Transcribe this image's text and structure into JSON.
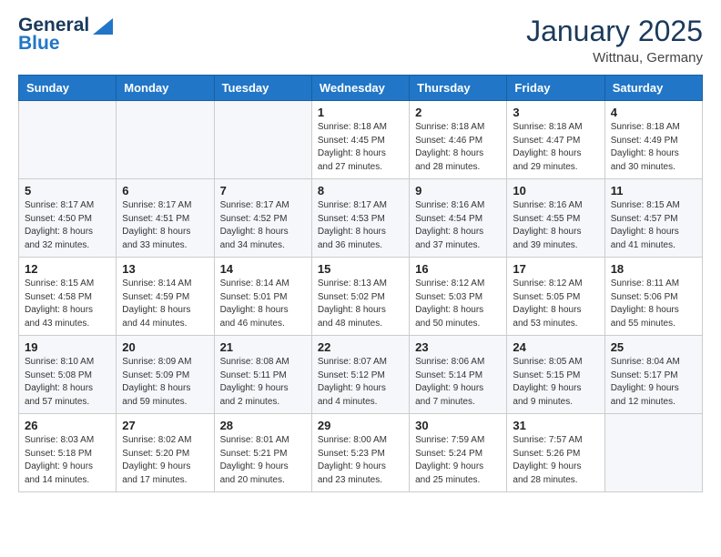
{
  "logo": {
    "general": "General",
    "blue": "Blue"
  },
  "title": "January 2025",
  "location": "Wittnau, Germany",
  "days_header": [
    "Sunday",
    "Monday",
    "Tuesday",
    "Wednesday",
    "Thursday",
    "Friday",
    "Saturday"
  ],
  "weeks": [
    [
      {
        "day": "",
        "info": ""
      },
      {
        "day": "",
        "info": ""
      },
      {
        "day": "",
        "info": ""
      },
      {
        "day": "1",
        "info": "Sunrise: 8:18 AM\nSunset: 4:45 PM\nDaylight: 8 hours and 27 minutes."
      },
      {
        "day": "2",
        "info": "Sunrise: 8:18 AM\nSunset: 4:46 PM\nDaylight: 8 hours and 28 minutes."
      },
      {
        "day": "3",
        "info": "Sunrise: 8:18 AM\nSunset: 4:47 PM\nDaylight: 8 hours and 29 minutes."
      },
      {
        "day": "4",
        "info": "Sunrise: 8:18 AM\nSunset: 4:49 PM\nDaylight: 8 hours and 30 minutes."
      }
    ],
    [
      {
        "day": "5",
        "info": "Sunrise: 8:17 AM\nSunset: 4:50 PM\nDaylight: 8 hours and 32 minutes."
      },
      {
        "day": "6",
        "info": "Sunrise: 8:17 AM\nSunset: 4:51 PM\nDaylight: 8 hours and 33 minutes."
      },
      {
        "day": "7",
        "info": "Sunrise: 8:17 AM\nSunset: 4:52 PM\nDaylight: 8 hours and 34 minutes."
      },
      {
        "day": "8",
        "info": "Sunrise: 8:17 AM\nSunset: 4:53 PM\nDaylight: 8 hours and 36 minutes."
      },
      {
        "day": "9",
        "info": "Sunrise: 8:16 AM\nSunset: 4:54 PM\nDaylight: 8 hours and 37 minutes."
      },
      {
        "day": "10",
        "info": "Sunrise: 8:16 AM\nSunset: 4:55 PM\nDaylight: 8 hours and 39 minutes."
      },
      {
        "day": "11",
        "info": "Sunrise: 8:15 AM\nSunset: 4:57 PM\nDaylight: 8 hours and 41 minutes."
      }
    ],
    [
      {
        "day": "12",
        "info": "Sunrise: 8:15 AM\nSunset: 4:58 PM\nDaylight: 8 hours and 43 minutes."
      },
      {
        "day": "13",
        "info": "Sunrise: 8:14 AM\nSunset: 4:59 PM\nDaylight: 8 hours and 44 minutes."
      },
      {
        "day": "14",
        "info": "Sunrise: 8:14 AM\nSunset: 5:01 PM\nDaylight: 8 hours and 46 minutes."
      },
      {
        "day": "15",
        "info": "Sunrise: 8:13 AM\nSunset: 5:02 PM\nDaylight: 8 hours and 48 minutes."
      },
      {
        "day": "16",
        "info": "Sunrise: 8:12 AM\nSunset: 5:03 PM\nDaylight: 8 hours and 50 minutes."
      },
      {
        "day": "17",
        "info": "Sunrise: 8:12 AM\nSunset: 5:05 PM\nDaylight: 8 hours and 53 minutes."
      },
      {
        "day": "18",
        "info": "Sunrise: 8:11 AM\nSunset: 5:06 PM\nDaylight: 8 hours and 55 minutes."
      }
    ],
    [
      {
        "day": "19",
        "info": "Sunrise: 8:10 AM\nSunset: 5:08 PM\nDaylight: 8 hours and 57 minutes."
      },
      {
        "day": "20",
        "info": "Sunrise: 8:09 AM\nSunset: 5:09 PM\nDaylight: 8 hours and 59 minutes."
      },
      {
        "day": "21",
        "info": "Sunrise: 8:08 AM\nSunset: 5:11 PM\nDaylight: 9 hours and 2 minutes."
      },
      {
        "day": "22",
        "info": "Sunrise: 8:07 AM\nSunset: 5:12 PM\nDaylight: 9 hours and 4 minutes."
      },
      {
        "day": "23",
        "info": "Sunrise: 8:06 AM\nSunset: 5:14 PM\nDaylight: 9 hours and 7 minutes."
      },
      {
        "day": "24",
        "info": "Sunrise: 8:05 AM\nSunset: 5:15 PM\nDaylight: 9 hours and 9 minutes."
      },
      {
        "day": "25",
        "info": "Sunrise: 8:04 AM\nSunset: 5:17 PM\nDaylight: 9 hours and 12 minutes."
      }
    ],
    [
      {
        "day": "26",
        "info": "Sunrise: 8:03 AM\nSunset: 5:18 PM\nDaylight: 9 hours and 14 minutes."
      },
      {
        "day": "27",
        "info": "Sunrise: 8:02 AM\nSunset: 5:20 PM\nDaylight: 9 hours and 17 minutes."
      },
      {
        "day": "28",
        "info": "Sunrise: 8:01 AM\nSunset: 5:21 PM\nDaylight: 9 hours and 20 minutes."
      },
      {
        "day": "29",
        "info": "Sunrise: 8:00 AM\nSunset: 5:23 PM\nDaylight: 9 hours and 23 minutes."
      },
      {
        "day": "30",
        "info": "Sunrise: 7:59 AM\nSunset: 5:24 PM\nDaylight: 9 hours and 25 minutes."
      },
      {
        "day": "31",
        "info": "Sunrise: 7:57 AM\nSunset: 5:26 PM\nDaylight: 9 hours and 28 minutes."
      },
      {
        "day": "",
        "info": ""
      }
    ]
  ]
}
